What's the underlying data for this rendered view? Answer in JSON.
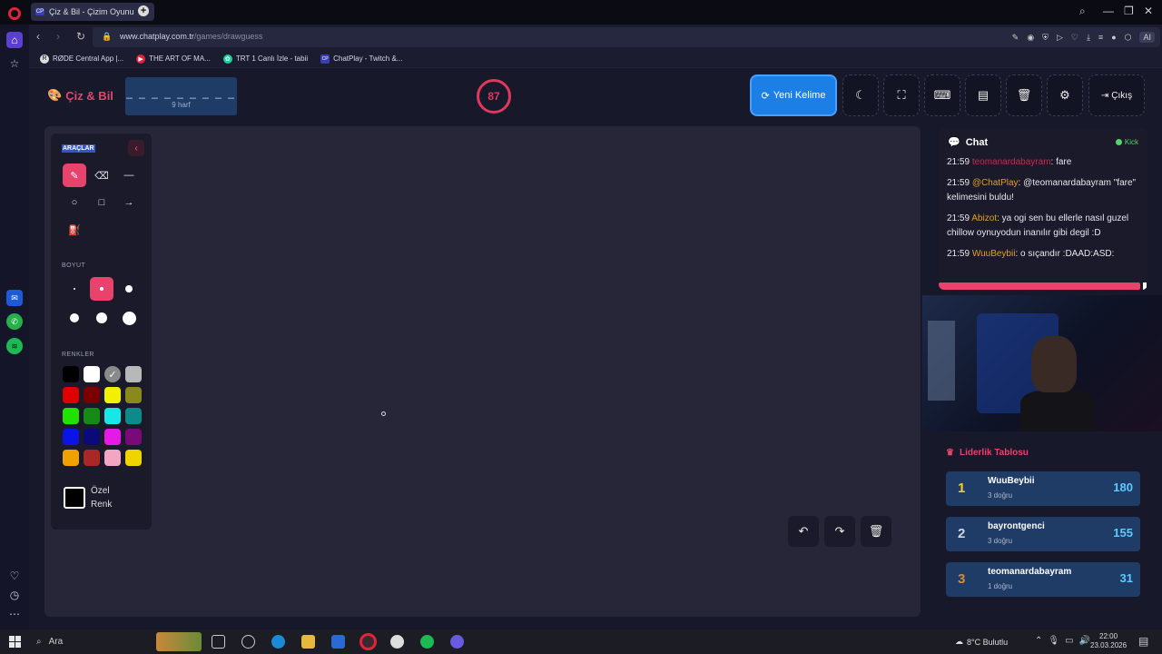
{
  "browser": {
    "tab_title": "Çiz & Bil - Çizim Oyunu",
    "tab_favicon": "CP",
    "address_domain": "www.chatplay.com.tr",
    "address_path": "/games/drawguess",
    "ai_label": "AI",
    "bookmarks": [
      {
        "label": "RØDE Central App |...",
        "icon": "R"
      },
      {
        "label": "THE ART OF MA...",
        "icon": "▶"
      },
      {
        "label": "TRT 1 Canlı İzle - tabii",
        "icon": "✿"
      },
      {
        "label": "ChatPlay - Twitch &...",
        "icon": "CP"
      }
    ]
  },
  "header": {
    "logo_text": "Çiz & Bil",
    "word_dashes": "_ _ _ _ _ _ _ _ _",
    "word_hint": "9 harf",
    "timer": "87",
    "new_word_label": "Yeni Kelime",
    "exit_label": "Çıkış"
  },
  "tools": {
    "title": "ARAÇLAR",
    "size_label": "BOYUT",
    "colors_label": "RENKLER",
    "custom_label_1": "Özel",
    "custom_label_2": "Renk",
    "colors": [
      "#000000",
      "#ffffff",
      "#8a8a8a",
      "#b8b8b8",
      "#e00000",
      "#7a0000",
      "#f0f000",
      "#8a8a1a",
      "#22e000",
      "#158a15",
      "#19e6e6",
      "#0d8a8a",
      "#0a14e6",
      "#0a0a7a",
      "#e61ae6",
      "#7a0a7a",
      "#f0a000",
      "#a82828",
      "#f2a6c4",
      "#f0d400"
    ]
  },
  "chat": {
    "title": "Chat",
    "platform": "Kick",
    "messages": [
      {
        "time": "21:59",
        "user": "teomanardabayram",
        "text": ": fare"
      },
      {
        "time": "21:59",
        "user": "@ChatPlay",
        "text": ": @teomanardabayram \"fare\" kelimesini buldu!"
      },
      {
        "time": "21:59",
        "user": "Abizot",
        "text": ": ya ogi sen bu ellerle nasıl guzel chillow oynuyodun inanılır gibi degil :D"
      },
      {
        "time": "21:59",
        "user": "WuuBeybii",
        "text": ": o sıçandır :DAAD:ASD:"
      }
    ]
  },
  "leaderboard": {
    "title": "Liderlik Tablosu",
    "rows": [
      {
        "rank": "1",
        "name": "WuuBeybii",
        "sub": "3 doğru",
        "score": "180",
        "rank_color": "#f5d020"
      },
      {
        "rank": "2",
        "name": "bayrontgenci",
        "sub": "3 doğru",
        "score": "155",
        "rank_color": "#d0d6e0"
      },
      {
        "rank": "3",
        "name": "teomanardabayram",
        "sub": "1 doğru",
        "score": "31",
        "rank_color": "#d78a3a"
      }
    ]
  },
  "taskbar": {
    "search_label": "Ara",
    "weather": "8°C  Bulutlu",
    "time": "22:00",
    "date": "23.03.2026"
  }
}
